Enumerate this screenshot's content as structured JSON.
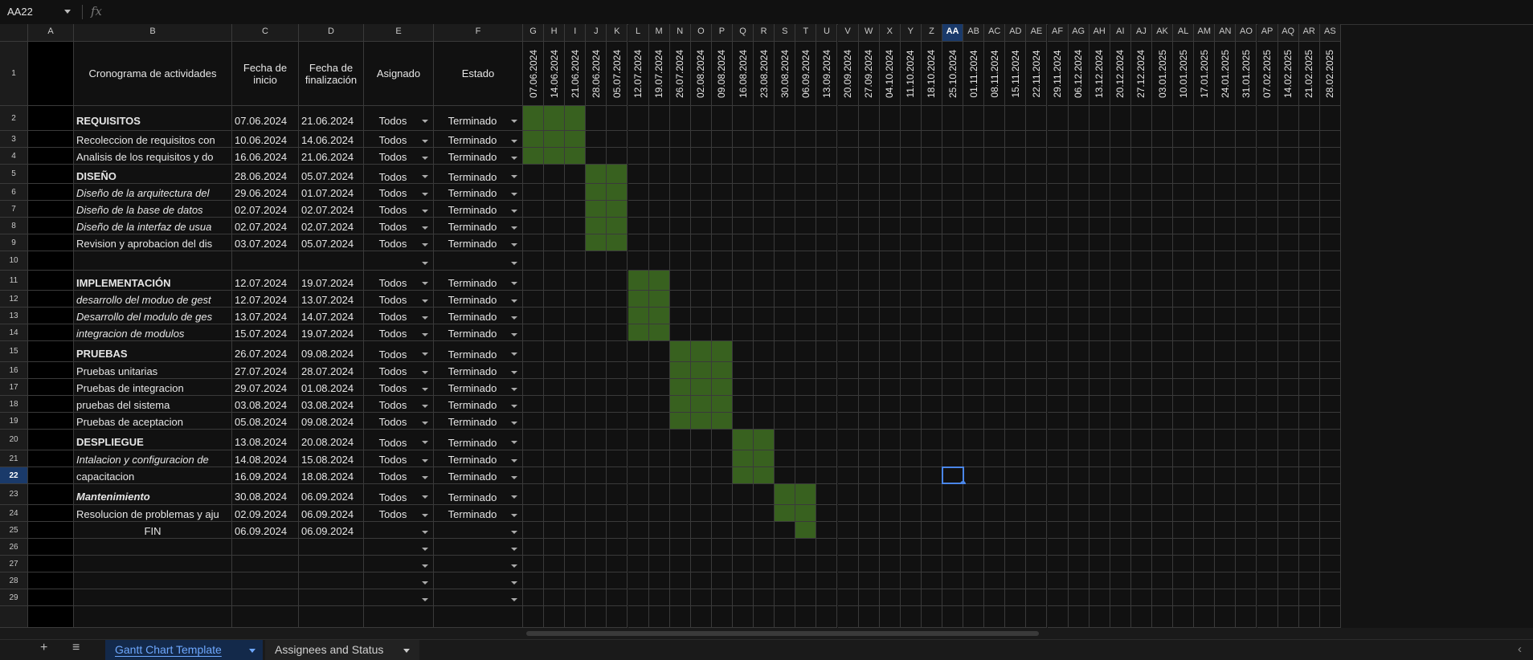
{
  "formula_bar": {
    "name_box": "AA22",
    "fx_label": "fx"
  },
  "columns": [
    "A",
    "B",
    "C",
    "D",
    "E",
    "F",
    "G",
    "H",
    "I",
    "J",
    "K",
    "L",
    "M",
    "N",
    "O",
    "P",
    "Q",
    "R",
    "S",
    "T",
    "U",
    "V",
    "W",
    "X",
    "Y",
    "Z",
    "AA",
    "AB",
    "AC",
    "AD",
    "AE",
    "AF",
    "AG",
    "AH",
    "AI",
    "AJ",
    "AK",
    "AL",
    "AM",
    "AN",
    "AO",
    "AP",
    "AQ",
    "AR",
    "AS"
  ],
  "selected_column": "AA",
  "selected_row": "22",
  "header_row": {
    "activities": "Cronograma de actividades",
    "start": "Fecha de inicio",
    "end": "Fecha de finalización",
    "assigned": "Asignado",
    "status": "Estado"
  },
  "timeline_dates": [
    "07.06.2024",
    "14.06.2024",
    "21.06.2024",
    "28.06.2024",
    "05.07.2024",
    "12.07.2024",
    "19.07.2024",
    "26.07.2024",
    "02.08.2024",
    "09.08.2024",
    "16.08.2024",
    "23.08.2024",
    "30.08.2024",
    "06.09.2024",
    "13.09.2024",
    "20.09.2024",
    "27.09.2024",
    "04.10.2024",
    "11.10.2024",
    "18.10.2024",
    "25.10.2024",
    "01.11.2024",
    "08.11.2024",
    "15.11.2024",
    "22.11.2024",
    "29.11.2024",
    "06.12.2024",
    "13.12.2024",
    "20.12.2024",
    "27.12.2024",
    "03.01.2025",
    "10.01.2025",
    "17.01.2025",
    "24.01.2025",
    "31.01.2025",
    "07.02.2025",
    "14.02.2025",
    "21.02.2025",
    "28.02.2025"
  ],
  "rows": [
    {
      "num": "2",
      "activity": "REQUISITOS",
      "style": "bold",
      "start": "07.06.2024",
      "end": "21.06.2024",
      "assigned": "Todos",
      "status": "Terminado",
      "gantt": [
        0,
        2
      ]
    },
    {
      "num": "3",
      "activity": "Recoleccion de requisitos con",
      "style": "normal",
      "start": "10.06.2024",
      "end": "14.06.2024",
      "assigned": "Todos",
      "status": "Terminado",
      "gantt": [
        0,
        2
      ]
    },
    {
      "num": "4",
      "activity": "Analisis de los requisitos y do",
      "style": "normal",
      "start": "16.06.2024",
      "end": "21.06.2024",
      "assigned": "Todos",
      "status": "Terminado",
      "gantt": [
        0,
        2
      ]
    },
    {
      "num": "5",
      "activity": "DISEÑO",
      "style": "bold",
      "start": "28.06.2024",
      "end": "05.07.2024",
      "assigned": "Todos",
      "status": "Terminado",
      "gantt": [
        3,
        4
      ]
    },
    {
      "num": "6",
      "activity": "Diseño de la arquitectura del",
      "style": "italic",
      "start": "29.06.2024",
      "end": "01.07.2024",
      "assigned": "Todos",
      "status": "Terminado",
      "gantt": [
        3,
        4
      ]
    },
    {
      "num": "7",
      "activity": "Diseño de la base de datos",
      "style": "italic",
      "start": "02.07.2024",
      "end": "02.07.2024",
      "assigned": "Todos",
      "status": "Terminado",
      "gantt": [
        3,
        4
      ]
    },
    {
      "num": "8",
      "activity": "Diseño de la interfaz de usua",
      "style": "italic",
      "start": "02.07.2024",
      "end": "02.07.2024",
      "assigned": "Todos",
      "status": "Terminado",
      "gantt": [
        3,
        4
      ]
    },
    {
      "num": "9",
      "activity": "Revision y aprobacion del dis",
      "style": "normal",
      "start": "03.07.2024",
      "end": "05.07.2024",
      "assigned": "Todos",
      "status": "Terminado",
      "gantt": [
        3,
        4
      ]
    },
    {
      "num": "10",
      "activity": "",
      "style": "normal",
      "start": "",
      "end": "",
      "assigned": "",
      "status": "",
      "gantt": null
    },
    {
      "num": "11",
      "activity": "IMPLEMENTACIÓN",
      "style": "bold",
      "start": "12.07.2024",
      "end": "19.07.2024",
      "assigned": "Todos",
      "status": "Terminado",
      "gantt": [
        5,
        6
      ]
    },
    {
      "num": "12",
      "activity": "desarrollo del moduo de gest",
      "style": "italic",
      "start": "12.07.2024",
      "end": "13.07.2024",
      "assigned": "Todos",
      "status": "Terminado",
      "gantt": [
        5,
        6
      ]
    },
    {
      "num": "13",
      "activity": "Desarrollo del modulo de ges",
      "style": "italic",
      "start": "13.07.2024",
      "end": "14.07.2024",
      "assigned": "Todos",
      "status": "Terminado",
      "gantt": [
        5,
        6
      ]
    },
    {
      "num": "14",
      "activity": "integracion de modulos",
      "style": "italic",
      "start": "15.07.2024",
      "end": "19.07.2024",
      "assigned": "Todos",
      "status": "Terminado",
      "gantt": [
        5,
        6
      ]
    },
    {
      "num": "15",
      "activity": "PRUEBAS",
      "style": "bold",
      "start": "26.07.2024",
      "end": "09.08.2024",
      "assigned": "Todos",
      "status": "Terminado",
      "gantt": [
        7,
        9
      ]
    },
    {
      "num": "16",
      "activity": "Pruebas unitarias",
      "style": "normal",
      "start": "27.07.2024",
      "end": "28.07.2024",
      "assigned": "Todos",
      "status": "Terminado",
      "gantt": [
        7,
        9
      ]
    },
    {
      "num": "17",
      "activity": "Pruebas de integracion",
      "style": "normal",
      "start": "29.07.2024",
      "end": "01.08.2024",
      "assigned": "Todos",
      "status": "Terminado",
      "gantt": [
        7,
        9
      ]
    },
    {
      "num": "18",
      "activity": "pruebas del sistema",
      "style": "normal",
      "start": "03.08.2024",
      "end": "03.08.2024",
      "assigned": "Todos",
      "status": "Terminado",
      "gantt": [
        7,
        9
      ]
    },
    {
      "num": "19",
      "activity": "Pruebas de aceptacion",
      "style": "normal",
      "start": "05.08.2024",
      "end": "09.08.2024",
      "assigned": "Todos",
      "status": "Terminado",
      "gantt": [
        7,
        9
      ]
    },
    {
      "num": "20",
      "activity": "DESPLIEGUE",
      "style": "bold",
      "start": "13.08.2024",
      "end": "20.08.2024",
      "assigned": "Todos",
      "status": "Terminado",
      "gantt": [
        10,
        11
      ]
    },
    {
      "num": "21",
      "activity": "Intalacion y configuracion de",
      "style": "italic",
      "start": "14.08.2024",
      "end": "15.08.2024",
      "assigned": "Todos",
      "status": "Terminado",
      "gantt": [
        10,
        11
      ]
    },
    {
      "num": "22",
      "activity": "capacitacion",
      "style": "normal",
      "start": "16.09.2024",
      "end": "18.08.2024",
      "assigned": "Todos",
      "status": "Terminado",
      "gantt": [
        10,
        11
      ]
    },
    {
      "num": "23",
      "activity": "Mantenimiento",
      "style": "bolditalic",
      "start": "30.08.2024",
      "end": "06.09.2024",
      "assigned": "Todos",
      "status": "Terminado",
      "gantt": [
        12,
        13
      ]
    },
    {
      "num": "24",
      "activity": "Resolucion de problemas y aju",
      "style": "normal",
      "start": "02.09.2024",
      "end": "06.09.2024",
      "assigned": "Todos",
      "status": "Terminado",
      "gantt": [
        12,
        13
      ]
    },
    {
      "num": "25",
      "activity": "FIN",
      "style": "center",
      "start": "06.09.2024",
      "end": "06.09.2024",
      "assigned": "",
      "status": "",
      "gantt": [
        13,
        13
      ]
    },
    {
      "num": "26",
      "activity": "",
      "style": "normal",
      "start": "",
      "end": "",
      "assigned": "",
      "status": "",
      "gantt": null
    },
    {
      "num": "27",
      "activity": "",
      "style": "normal",
      "start": "",
      "end": "",
      "assigned": "",
      "status": "",
      "gantt": null
    },
    {
      "num": "28",
      "activity": "",
      "style": "normal",
      "start": "",
      "end": "",
      "assigned": "",
      "status": "",
      "gantt": null
    },
    {
      "num": "29",
      "activity": "",
      "style": "normal",
      "start": "",
      "end": "",
      "assigned": "",
      "status": "",
      "gantt": null
    }
  ],
  "colors": {
    "gantt_fill": "#38611f",
    "selection": "#4a86e8"
  },
  "sheet_tabs": [
    {
      "label": "Gantt Chart Template",
      "active": true
    },
    {
      "label": "Assignees and Status",
      "active": false
    }
  ],
  "tab_bar": {
    "add_icon": "+",
    "menu_icon": "≡",
    "nav_icon": "‹"
  }
}
